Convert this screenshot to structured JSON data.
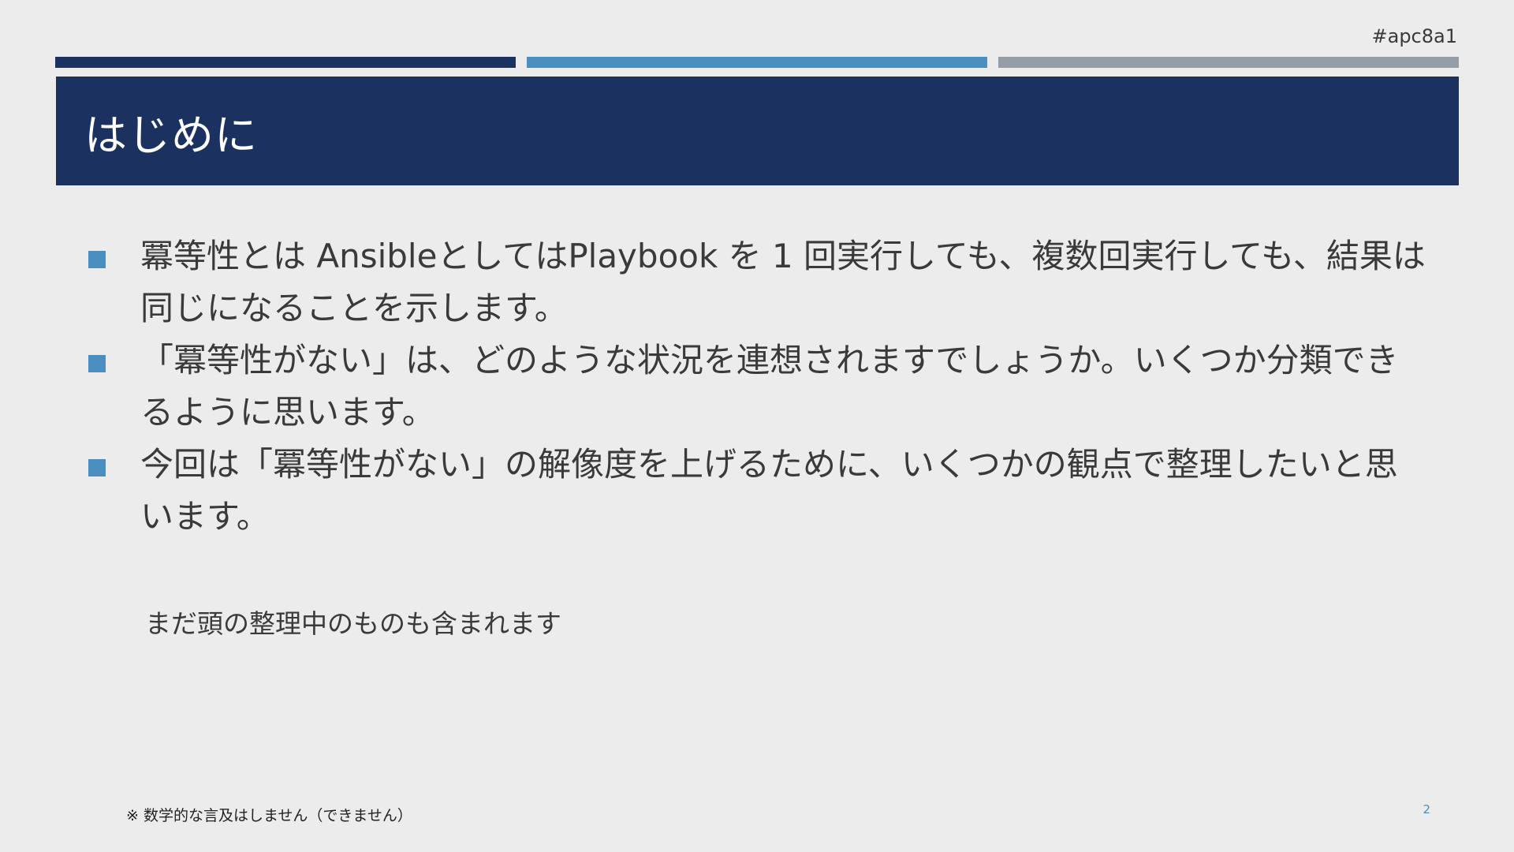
{
  "slide": {
    "tag": "#apc8a1",
    "title": "はじめに",
    "bullets": [
      "冪等性とは AnsibleとしてはPlaybook を 1 回実行しても、複数回実行しても、結果は同じになることを示します。",
      "「冪等性がない」は、どのような状況を連想されますでしょうか。いくつか分類できるように思います。",
      "今回は「冪等性がない」の解像度を上げるために、いくつかの観点で整理したいと思います。"
    ],
    "note": "まだ頭の整理中のものも含まれます",
    "footnote": "※ 数学的な言及はしません（できません）",
    "page_number": "2"
  },
  "colors": {
    "background": "#ececec",
    "title_banner": "#1b3160",
    "accent_bars": [
      "#1b3160",
      "#4a8fbf",
      "#959ea6"
    ],
    "bullet_marker": "#4a8fbf"
  }
}
